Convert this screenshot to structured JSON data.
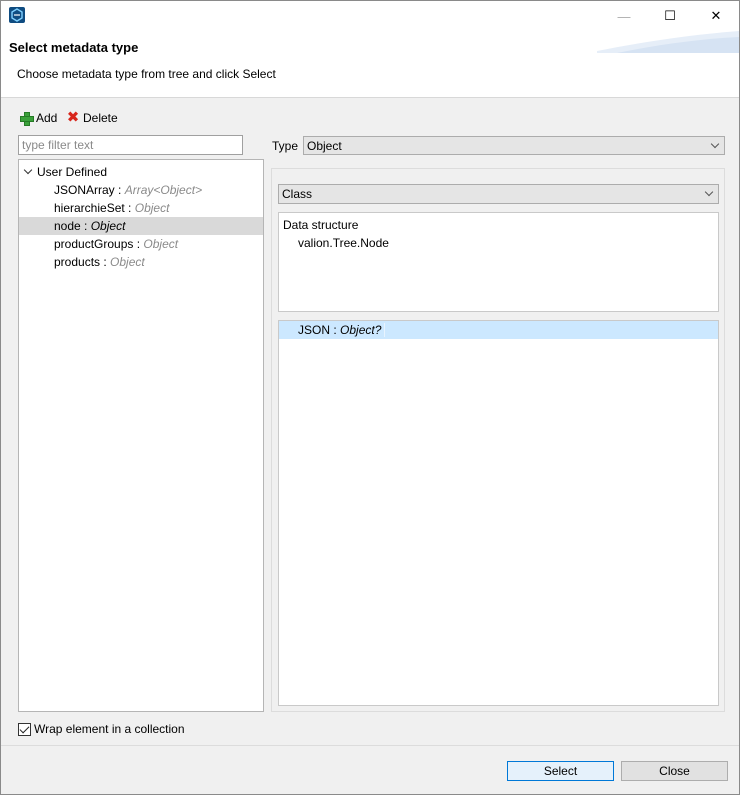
{
  "window": {
    "minimize_glyph": "—",
    "maximize_glyph": "☐",
    "close_glyph": "✕"
  },
  "header": {
    "title": "Select metadata type",
    "description": "Choose metadata type from tree and click Select"
  },
  "toolbar": {
    "add_label": "Add",
    "delete_label": "Delete"
  },
  "filter": {
    "placeholder": "type filter text",
    "value": ""
  },
  "tree": {
    "root_label": "User Defined",
    "items": [
      {
        "name": "JSONArray",
        "sep": " : ",
        "type": "Array<Object>",
        "selected": false
      },
      {
        "name": "hierarchieSet",
        "sep": " : ",
        "type": "Object",
        "selected": false
      },
      {
        "name": "node",
        "sep": " : ",
        "type": "Object",
        "selected": true
      },
      {
        "name": "productGroups",
        "sep": " : ",
        "type": "Object",
        "selected": false
      },
      {
        "name": "products",
        "sep": " : ",
        "type": "Object",
        "selected": false
      }
    ]
  },
  "type_selector": {
    "label": "Type",
    "value": "Object"
  },
  "class_selector": {
    "value": "Class"
  },
  "data_structure": {
    "title": "Data structure",
    "value": "valion.Tree.Node"
  },
  "members": {
    "row_name": "JSON",
    "row_sep": " : ",
    "row_type": "Object?"
  },
  "options": {
    "wrap_label": "Wrap element in a collection",
    "wrap_checked": true
  },
  "footer": {
    "select_label": "Select",
    "close_label": "Close"
  },
  "colors": {
    "selection": "#d9d9d9",
    "member_highlight": "#cce8ff",
    "default_button_border": "#0078d7"
  }
}
